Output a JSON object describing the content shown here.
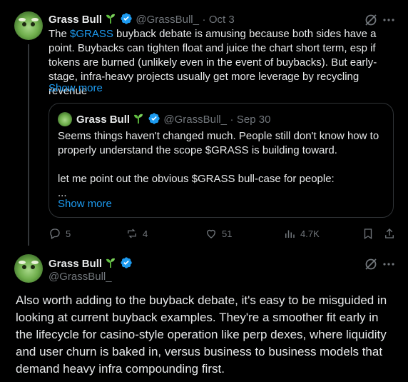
{
  "tweet1": {
    "name": "Grass Bull",
    "handle": "@GrassBull_",
    "sep": "·",
    "date": "Oct 3",
    "text_pre": "The ",
    "cashtag": "$GRASS",
    "text_post": " buyback debate is amusing because both sides have a point. Buybacks can tighten float and juice the chart short term, esp if tokens are burned (unlikely even in the event of buybacks). But early-stage, infra-heavy projects usually get more leverage by recycling revenue",
    "show_more": "Show more",
    "quote": {
      "name": "Grass Bull",
      "handle": "@GrassBull_",
      "sep": "·",
      "date": "Sep 30",
      "line1": "Seems things haven't changed much. People still don't know how to",
      "line2": "properly understand the scope $GRASS is building toward.",
      "line3": "let me point out the obvious $GRASS bull-case for people:",
      "line4": "...",
      "show_more": "Show more"
    },
    "actions": {
      "replies": "5",
      "reposts": "4",
      "likes": "51",
      "views": "4.7K"
    }
  },
  "tweet2": {
    "name": "Grass Bull",
    "handle": "@GrassBull_",
    "text": "Also worth adding to the buyback debate, it's easy to be misguided in looking at current buyback examples. They're a smoother fit early in the lifecycle for casino-style operation like perp dexes, where liquidity and user churn is baked in, versus business to business models that demand heavy infra compounding first."
  },
  "colors": {
    "background": "#000000",
    "text": "#e7e9ea",
    "muted": "#71767b",
    "accent": "#1d9bf0",
    "border": "#2f3336"
  },
  "icons": [
    "sprout-icon",
    "verified-badge-icon",
    "grok-icon",
    "more-icon",
    "reply-icon",
    "repost-icon",
    "like-icon",
    "views-icon",
    "bookmark-icon",
    "share-icon"
  ]
}
